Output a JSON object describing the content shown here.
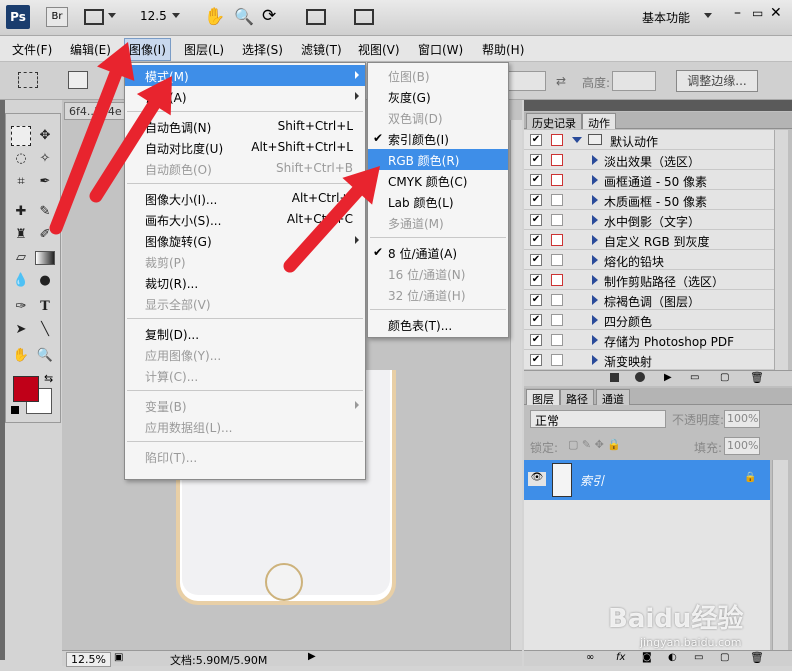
{
  "appbar": {
    "logo": "Ps",
    "bridge": "Br",
    "zoom": "12.5",
    "workspace": "基本功能"
  },
  "menubar": [
    {
      "label": "文件(F)"
    },
    {
      "label": "编辑(E)"
    },
    {
      "label": "图像(I)"
    },
    {
      "label": "图层(L)"
    },
    {
      "label": "选择(S)"
    },
    {
      "label": "滤镜(T)"
    },
    {
      "label": "视图(V)"
    },
    {
      "label": "窗口(W)"
    },
    {
      "label": "帮助(H)"
    }
  ],
  "options": {
    "height_label": "高度:",
    "refine_edge": "调整边缘..."
  },
  "doc": {
    "tab": "6f4..164e",
    "zoom": "12.5%",
    "status": "文档:5.90M/5.90M"
  },
  "image_menu": [
    {
      "label": "模式(M)",
      "shortcut": "",
      "disabled": false,
      "highlight": true,
      "sub": true
    },
    {
      "label": "调整(A)",
      "shortcut": "",
      "disabled": false,
      "sub": true
    },
    {
      "label": "自动色调(N)",
      "shortcut": "Shift+Ctrl+L",
      "disabled": false
    },
    {
      "label": "自动对比度(U)",
      "shortcut": "Alt+Shift+Ctrl+L",
      "disabled": false
    },
    {
      "label": "自动颜色(O)",
      "shortcut": "Shift+Ctrl+B",
      "disabled": true
    },
    {
      "label": "图像大小(I)...",
      "shortcut": "Alt+Ctrl+I",
      "disabled": false
    },
    {
      "label": "画布大小(S)...",
      "shortcut": "Alt+Ctrl+C",
      "disabled": false
    },
    {
      "label": "图像旋转(G)",
      "shortcut": "",
      "disabled": false,
      "sub": true
    },
    {
      "label": "裁剪(P)",
      "shortcut": "",
      "disabled": true
    },
    {
      "label": "裁切(R)...",
      "shortcut": "",
      "disabled": false
    },
    {
      "label": "显示全部(V)",
      "shortcut": "",
      "disabled": true
    },
    {
      "label": "复制(D)...",
      "shortcut": "",
      "disabled": false
    },
    {
      "label": "应用图像(Y)...",
      "shortcut": "",
      "disabled": true
    },
    {
      "label": "计算(C)...",
      "shortcut": "",
      "disabled": true
    },
    {
      "label": "变量(B)",
      "shortcut": "",
      "disabled": true,
      "sub": true
    },
    {
      "label": "应用数据组(L)...",
      "shortcut": "",
      "disabled": true
    },
    {
      "label": "陷印(T)...",
      "shortcut": "",
      "disabled": true
    }
  ],
  "mode_menu": [
    {
      "label": "位图(B)",
      "disabled": true,
      "checked": false
    },
    {
      "label": "灰度(G)",
      "disabled": false,
      "checked": false
    },
    {
      "label": "双色调(D)",
      "disabled": true,
      "checked": false
    },
    {
      "label": "索引颜色(I)",
      "disabled": false,
      "checked": true
    },
    {
      "label": "RGB 颜色(R)",
      "disabled": false,
      "checked": false,
      "highlight": true
    },
    {
      "label": "CMYK 颜色(C)",
      "disabled": false,
      "checked": false
    },
    {
      "label": "Lab 颜色(L)",
      "disabled": false,
      "checked": false
    },
    {
      "label": "多通道(M)",
      "disabled": true,
      "checked": false
    },
    {
      "label": "8 位/通道(A)",
      "disabled": false,
      "checked": true
    },
    {
      "label": "16 位/通道(N)",
      "disabled": true,
      "checked": false
    },
    {
      "label": "32 位/通道(H)",
      "disabled": true,
      "checked": false
    },
    {
      "label": "颜色表(T)...",
      "disabled": false,
      "checked": false
    }
  ],
  "history_panel": {
    "tabs": [
      "历史记录",
      "动作"
    ],
    "active_tab": "动作"
  },
  "actions": [
    {
      "label": "默认动作",
      "folder": true
    },
    {
      "label": "淡出效果（选区）"
    },
    {
      "label": "画框通道 - 50 像素"
    },
    {
      "label": "木质画框 - 50 像素"
    },
    {
      "label": "水中倒影（文字）"
    },
    {
      "label": "自定义 RGB 到灰度"
    },
    {
      "label": "熔化的铅块"
    },
    {
      "label": "制作剪贴路径（选区）"
    },
    {
      "label": "棕褐色调（图层）"
    },
    {
      "label": "四分颜色"
    },
    {
      "label": "存储为 Photoshop PDF"
    },
    {
      "label": "渐变映射"
    }
  ],
  "layers_panel": {
    "tabs": [
      "图层",
      "路径",
      "通道"
    ],
    "blend_mode": "正常",
    "opacity_label": "不透明度:",
    "opacity": "100%",
    "lock_label": "锁定:",
    "fill_label": "填充:",
    "fill": "100%",
    "layer_name": "索引"
  },
  "colors": {
    "foreground": "#c00018",
    "highlight": "#3e8ee8",
    "arrow": "#e8242e"
  },
  "watermark": "Baidu经验",
  "watermark_url": "jingyan.baidu.com"
}
